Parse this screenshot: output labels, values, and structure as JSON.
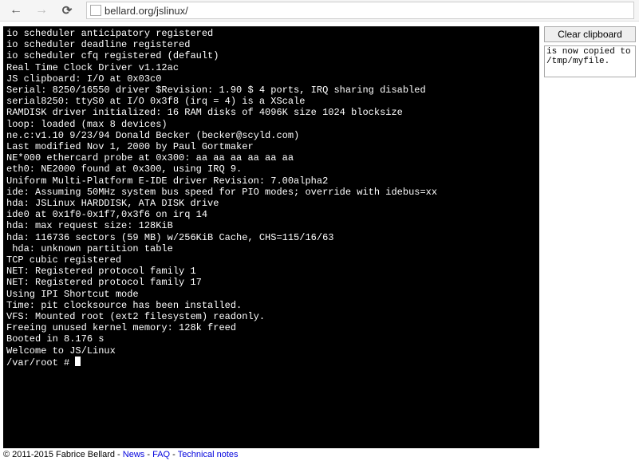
{
  "browser": {
    "url_display": "bellard.org/jslinux/"
  },
  "terminal": {
    "lines": [
      "io scheduler anticipatory registered",
      "io scheduler deadline registered",
      "io scheduler cfq registered (default)",
      "Real Time Clock Driver v1.12ac",
      "JS clipboard: I/O at 0x03c0",
      "Serial: 8250/16550 driver $Revision: 1.90 $ 4 ports, IRQ sharing disabled",
      "serial8250: ttyS0 at I/O 0x3f8 (irq = 4) is a XScale",
      "RAMDISK driver initialized: 16 RAM disks of 4096K size 1024 blocksize",
      "loop: loaded (max 8 devices)",
      "ne.c:v1.10 9/23/94 Donald Becker (becker@scyld.com)",
      "Last modified Nov 1, 2000 by Paul Gortmaker",
      "NE*000 ethercard probe at 0x300: aa aa aa aa aa aa",
      "eth0: NE2000 found at 0x300, using IRQ 9.",
      "Uniform Multi-Platform E-IDE driver Revision: 7.00alpha2",
      "ide: Assuming 50MHz system bus speed for PIO modes; override with idebus=xx",
      "hda: JSLinux HARDDISK, ATA DISK drive",
      "ide0 at 0x1f0-0x1f7,0x3f6 on irq 14",
      "hda: max request size: 128KiB",
      "hda: 116736 sectors (59 MB) w/256KiB Cache, CHS=115/16/63",
      " hda: unknown partition table",
      "TCP cubic registered",
      "NET: Registered protocol family 1",
      "NET: Registered protocol family 17",
      "Using IPI Shortcut mode",
      "Time: pit clocksource has been installed.",
      "VFS: Mounted root (ext2 filesystem) readonly.",
      "Freeing unused kernel memory: 128k freed",
      "Booted in 8.176 s",
      "Welcome to JS/Linux",
      "/var/root #"
    ]
  },
  "side": {
    "clear_label": "Clear clipboard",
    "clipboard_text": "is now copied to /tmp/myfile."
  },
  "footer": {
    "copyright": "© 2011-2015 Fabrice Bellard - ",
    "news": "News",
    "sep": " - ",
    "faq": "FAQ",
    "tech": "Technical notes"
  }
}
